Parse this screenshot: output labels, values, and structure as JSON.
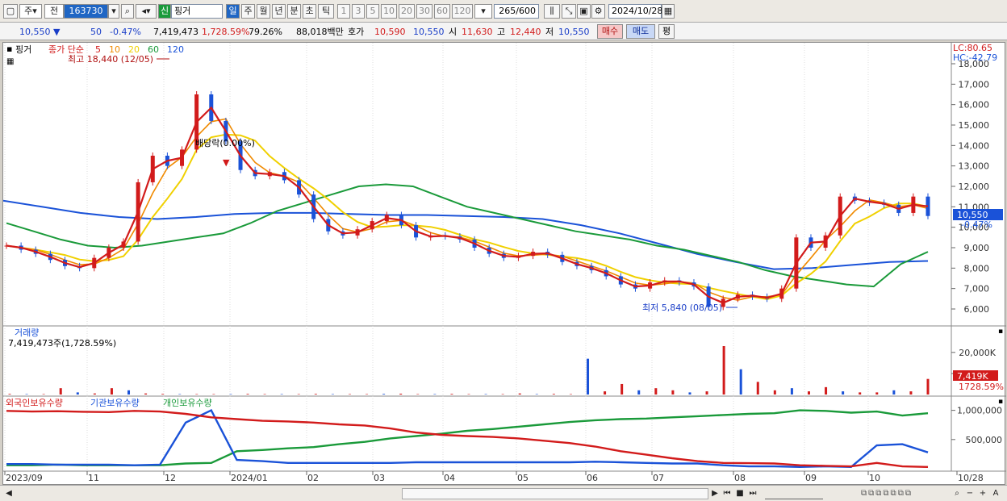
{
  "toolbar": {
    "market": "주",
    "ref": "전",
    "code": "163730",
    "stock_name": "핑거",
    "badge": "신",
    "period_tabs": [
      "일",
      "주",
      "월",
      "년",
      "분",
      "초",
      "틱"
    ],
    "active_period": "일",
    "intervals": [
      "1",
      "3",
      "5",
      "10",
      "20",
      "30",
      "60",
      "120"
    ],
    "count": "265",
    "count_total": "/600",
    "date": "2024/10/28"
  },
  "quote": {
    "price": "10,550",
    "arrow": "▼",
    "change": "50",
    "change_pct": "-0.47%",
    "volume": "7,419,473",
    "volume_ratio": "1,728.59%",
    "turnover": "79.26%",
    "amount": "88,018백만",
    "bid_label": "호가",
    "bid": "10,590",
    "ask": "10,550",
    "open_label": "시",
    "open": "11,630",
    "high_label": "고",
    "high": "12,440",
    "low_label": "저",
    "low": "10,550",
    "buy_button": "매수",
    "sell_button": "매도",
    "eval_button": "평"
  },
  "chart_data": [
    {
      "type": "candlestick",
      "title": "핑거",
      "legend": [
        "종가 단순",
        "5",
        "10",
        "20",
        "60",
        "120"
      ],
      "legend_colors": [
        "#d21b1b",
        "#d21b1b",
        "#f08a00",
        "#f0d000",
        "#1a9a3a",
        "#1a52d8"
      ],
      "y_ticks": [
        "18,000",
        "17,000",
        "16,000",
        "15,000",
        "14,000",
        "13,000",
        "12,000",
        "11,000",
        "10,000",
        "9,000",
        "8,000",
        "7,000",
        "6,000"
      ],
      "ylim": [
        5400,
        18500
      ],
      "current_price_label": "10,550",
      "current_change_label": "-0.47%",
      "lc_label": "LC:80.65",
      "hc_label": "HC:-42.79",
      "high_annotation": "최고 18,440 (12/05)",
      "low_annotation": "최저 5,840 (08/05)",
      "dividend_annotation": "배당락(0.00%)",
      "x_ticks": [
        "2023/09",
        "11",
        "12",
        "2024/01",
        "02",
        "03",
        "04",
        "05",
        "06",
        "07",
        "08",
        "09",
        "10",
        "10/28"
      ],
      "close_series": [
        9100,
        8900,
        8700,
        8400,
        8100,
        8000,
        8500,
        9000,
        9300,
        12200,
        13500,
        13000,
        13800,
        16500,
        15200,
        14200,
        12800,
        12500,
        12700,
        12300,
        11600,
        10400,
        9800,
        9600,
        9900,
        10300,
        10600,
        10100,
        9500,
        9600,
        9550,
        9400,
        9000,
        8700,
        8500,
        8600,
        8800,
        8650,
        8300,
        8100,
        7900,
        7600,
        7200,
        7000,
        7300,
        7400,
        7300,
        7100,
        6100,
        6500,
        6700,
        6600,
        6500,
        7000,
        9500,
        9000,
        9600,
        11500,
        11300,
        11200,
        11100,
        10700,
        11500,
        10550
      ],
      "ma60": [
        10200,
        9800,
        9400,
        9100,
        9000,
        9100,
        9300,
        9500,
        9700,
        10200,
        10800,
        11200,
        11600,
        12000,
        12100,
        12000,
        11500,
        11000,
        10700,
        10400,
        10100,
        9800,
        9600,
        9400,
        9100,
        8900,
        8600,
        8300,
        7900,
        7600,
        7400,
        7200,
        7100,
        8200,
        8800
      ],
      "ma120": [
        11300,
        11000,
        10700,
        10500,
        10400,
        10500,
        10650,
        10700,
        10700,
        10650,
        10600,
        10600,
        10550,
        10500,
        10400,
        10100,
        9700,
        9200,
        8700,
        8300,
        7950,
        8000,
        8150,
        8300,
        8350
      ]
    },
    {
      "type": "bar",
      "title": "거래량",
      "summary": "7,419,473주(1,728.59%)",
      "y_ticks": [
        "20,000K",
        "10,000K"
      ],
      "current_label": "7,419K",
      "current_ratio_label": "1728.59%",
      "values": [
        0.3,
        0.2,
        0.2,
        3,
        1,
        0.5,
        3,
        2,
        0.5,
        0.3,
        0.2,
        0.2,
        0.2,
        0.2,
        0.3,
        0.2,
        0.2,
        0.2,
        0.3,
        0.2,
        0.2,
        0.2,
        0.3,
        0.4,
        0.2,
        0.2,
        0.3,
        0.2,
        0.2,
        0.2,
        0.5,
        0.2,
        0.3,
        0.2,
        17,
        1.5,
        5,
        2,
        3,
        2,
        1,
        1.5,
        23,
        12,
        6,
        2,
        3,
        1.5,
        3.5,
        1.5,
        1,
        1,
        2,
        1.5,
        7.4
      ]
    },
    {
      "type": "line",
      "series_names": [
        "외국인보유수량",
        "기관보유수량",
        "개인보유수량"
      ],
      "series_colors": [
        "#d21b1b",
        "#1a52d8",
        "#1a9a3a"
      ],
      "y_ticks": [
        "1,000,000",
        "500,000"
      ],
      "foreign": [
        990,
        980,
        985,
        975,
        970,
        990,
        980,
        940,
        880,
        850,
        820,
        810,
        790,
        760,
        740,
        690,
        620,
        580,
        560,
        545,
        520,
        480,
        440,
        380,
        300,
        240,
        180,
        130,
        100,
        95,
        90,
        60,
        50,
        40,
        100,
        40,
        30
      ],
      "institution": [
        80,
        80,
        70,
        70,
        70,
        60,
        70,
        790,
        1000,
        150,
        130,
        100,
        100,
        100,
        100,
        100,
        110,
        110,
        110,
        110,
        110,
        110,
        110,
        120,
        110,
        100,
        90,
        90,
        60,
        40,
        40,
        30,
        40,
        30,
        400,
        420,
        280
      ],
      "individual": [
        60,
        60,
        70,
        60,
        60,
        60,
        60,
        90,
        100,
        300,
        320,
        350,
        370,
        420,
        460,
        520,
        560,
        600,
        650,
        680,
        720,
        760,
        800,
        830,
        850,
        860,
        880,
        900,
        920,
        940,
        950,
        1000,
        990,
        960,
        980,
        910,
        950
      ]
    }
  ],
  "scrollbar": {
    "zoom_controls": [
      "−",
      "+",
      "A"
    ]
  }
}
